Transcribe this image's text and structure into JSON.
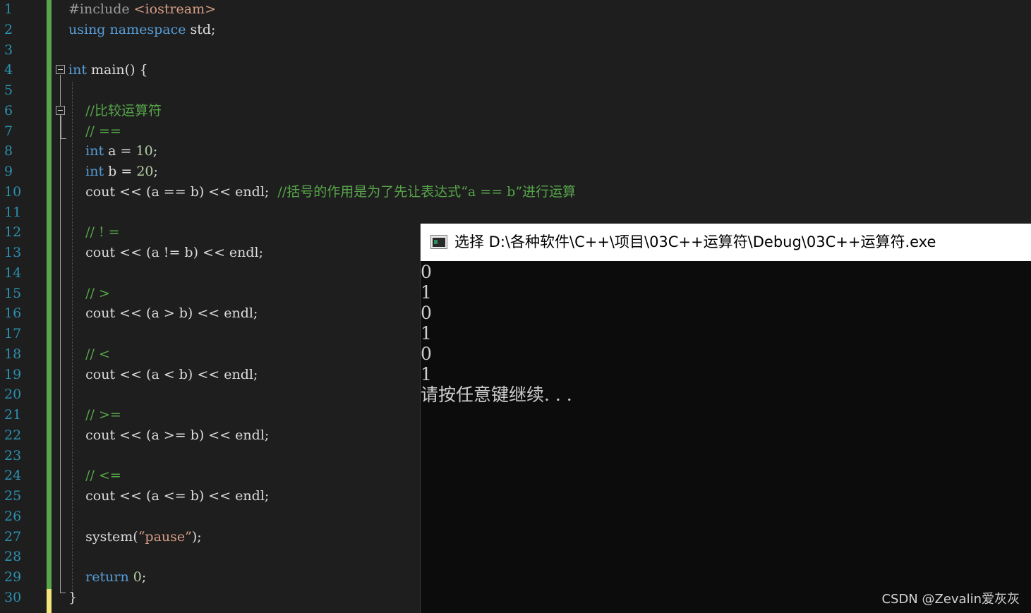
{
  "editor": {
    "line_numbers": [
      "1",
      "2",
      "3",
      "4",
      "5",
      "6",
      "7",
      "8",
      "9",
      "10",
      "11",
      "12",
      "13",
      "14",
      "15",
      "16",
      "17",
      "18",
      "19",
      "20",
      "21",
      "22",
      "23",
      "24",
      "25",
      "26",
      "27",
      "28",
      "29",
      "30"
    ],
    "lines": [
      [
        {
          "t": "#include ",
          "c": "pp"
        },
        {
          "t": "<iostream>",
          "c": "str"
        }
      ],
      [
        {
          "t": "using",
          "c": "kw"
        },
        {
          "t": " ",
          "c": ""
        },
        {
          "t": "namespace",
          "c": "kw"
        },
        {
          "t": " std;",
          "c": ""
        }
      ],
      [],
      [
        {
          "t": "int",
          "c": "kw"
        },
        {
          "t": " main() {",
          "c": ""
        }
      ],
      [],
      [
        {
          "t": "    //比较运算符",
          "c": "cm"
        }
      ],
      [
        {
          "t": "    // ==",
          "c": "cm"
        }
      ],
      [
        {
          "t": "    ",
          "c": ""
        },
        {
          "t": "int",
          "c": "kw"
        },
        {
          "t": " a = ",
          "c": ""
        },
        {
          "t": "10",
          "c": "num"
        },
        {
          "t": ";",
          "c": ""
        }
      ],
      [
        {
          "t": "    ",
          "c": ""
        },
        {
          "t": "int",
          "c": "kw"
        },
        {
          "t": " b = ",
          "c": ""
        },
        {
          "t": "20",
          "c": "num"
        },
        {
          "t": ";",
          "c": ""
        }
      ],
      [
        {
          "t": "    cout << (a == b) << endl;  ",
          "c": ""
        },
        {
          "t": "//括号的作用是为了先让表达式“a == b”进行运算",
          "c": "cm"
        }
      ],
      [],
      [
        {
          "t": "    // ! =",
          "c": "cm"
        }
      ],
      [
        {
          "t": "    cout << (a != b) << endl;",
          "c": ""
        }
      ],
      [],
      [
        {
          "t": "    // >",
          "c": "cm"
        }
      ],
      [
        {
          "t": "    cout << (a > b) << endl;",
          "c": ""
        }
      ],
      [],
      [
        {
          "t": "    // <",
          "c": "cm"
        }
      ],
      [
        {
          "t": "    cout << (a < b) << endl;",
          "c": ""
        }
      ],
      [],
      [
        {
          "t": "    // >=",
          "c": "cm"
        }
      ],
      [
        {
          "t": "    cout << (a >= b) << endl;",
          "c": ""
        }
      ],
      [],
      [
        {
          "t": "    // <=",
          "c": "cm"
        }
      ],
      [
        {
          "t": "    cout << (a <= b) << endl;",
          "c": ""
        }
      ],
      [],
      [
        {
          "t": "    system(",
          "c": ""
        },
        {
          "t": "“pause”",
          "c": "str"
        },
        {
          "t": ");",
          "c": ""
        }
      ],
      [],
      [
        {
          "t": "    ",
          "c": ""
        },
        {
          "t": "return",
          "c": "kw"
        },
        {
          "t": " ",
          "c": ""
        },
        {
          "t": "0",
          "c": "num"
        },
        {
          "t": ";",
          "c": ""
        }
      ],
      [
        {
          "t": "}",
          "c": ""
        }
      ]
    ]
  },
  "console": {
    "title": "选择 D:\\各种软件\\C++\\项目\\03C++运算符\\Debug\\03C++运算符.exe",
    "icon": "console-window-icon",
    "output": [
      "0",
      "1",
      "0",
      "1",
      "0",
      "1",
      "请按任意键继续. . ."
    ]
  },
  "watermark": "CSDN @Zevalin爱灰灰",
  "colors": {
    "editor_bg": "#1e1e1e",
    "line_number": "#2b91af",
    "keyword": "#569cd6",
    "comment": "#57a64a",
    "string": "#d69d85",
    "number": "#b5cea8",
    "console_bg": "#0c0c0c",
    "console_text": "#cccccc"
  }
}
